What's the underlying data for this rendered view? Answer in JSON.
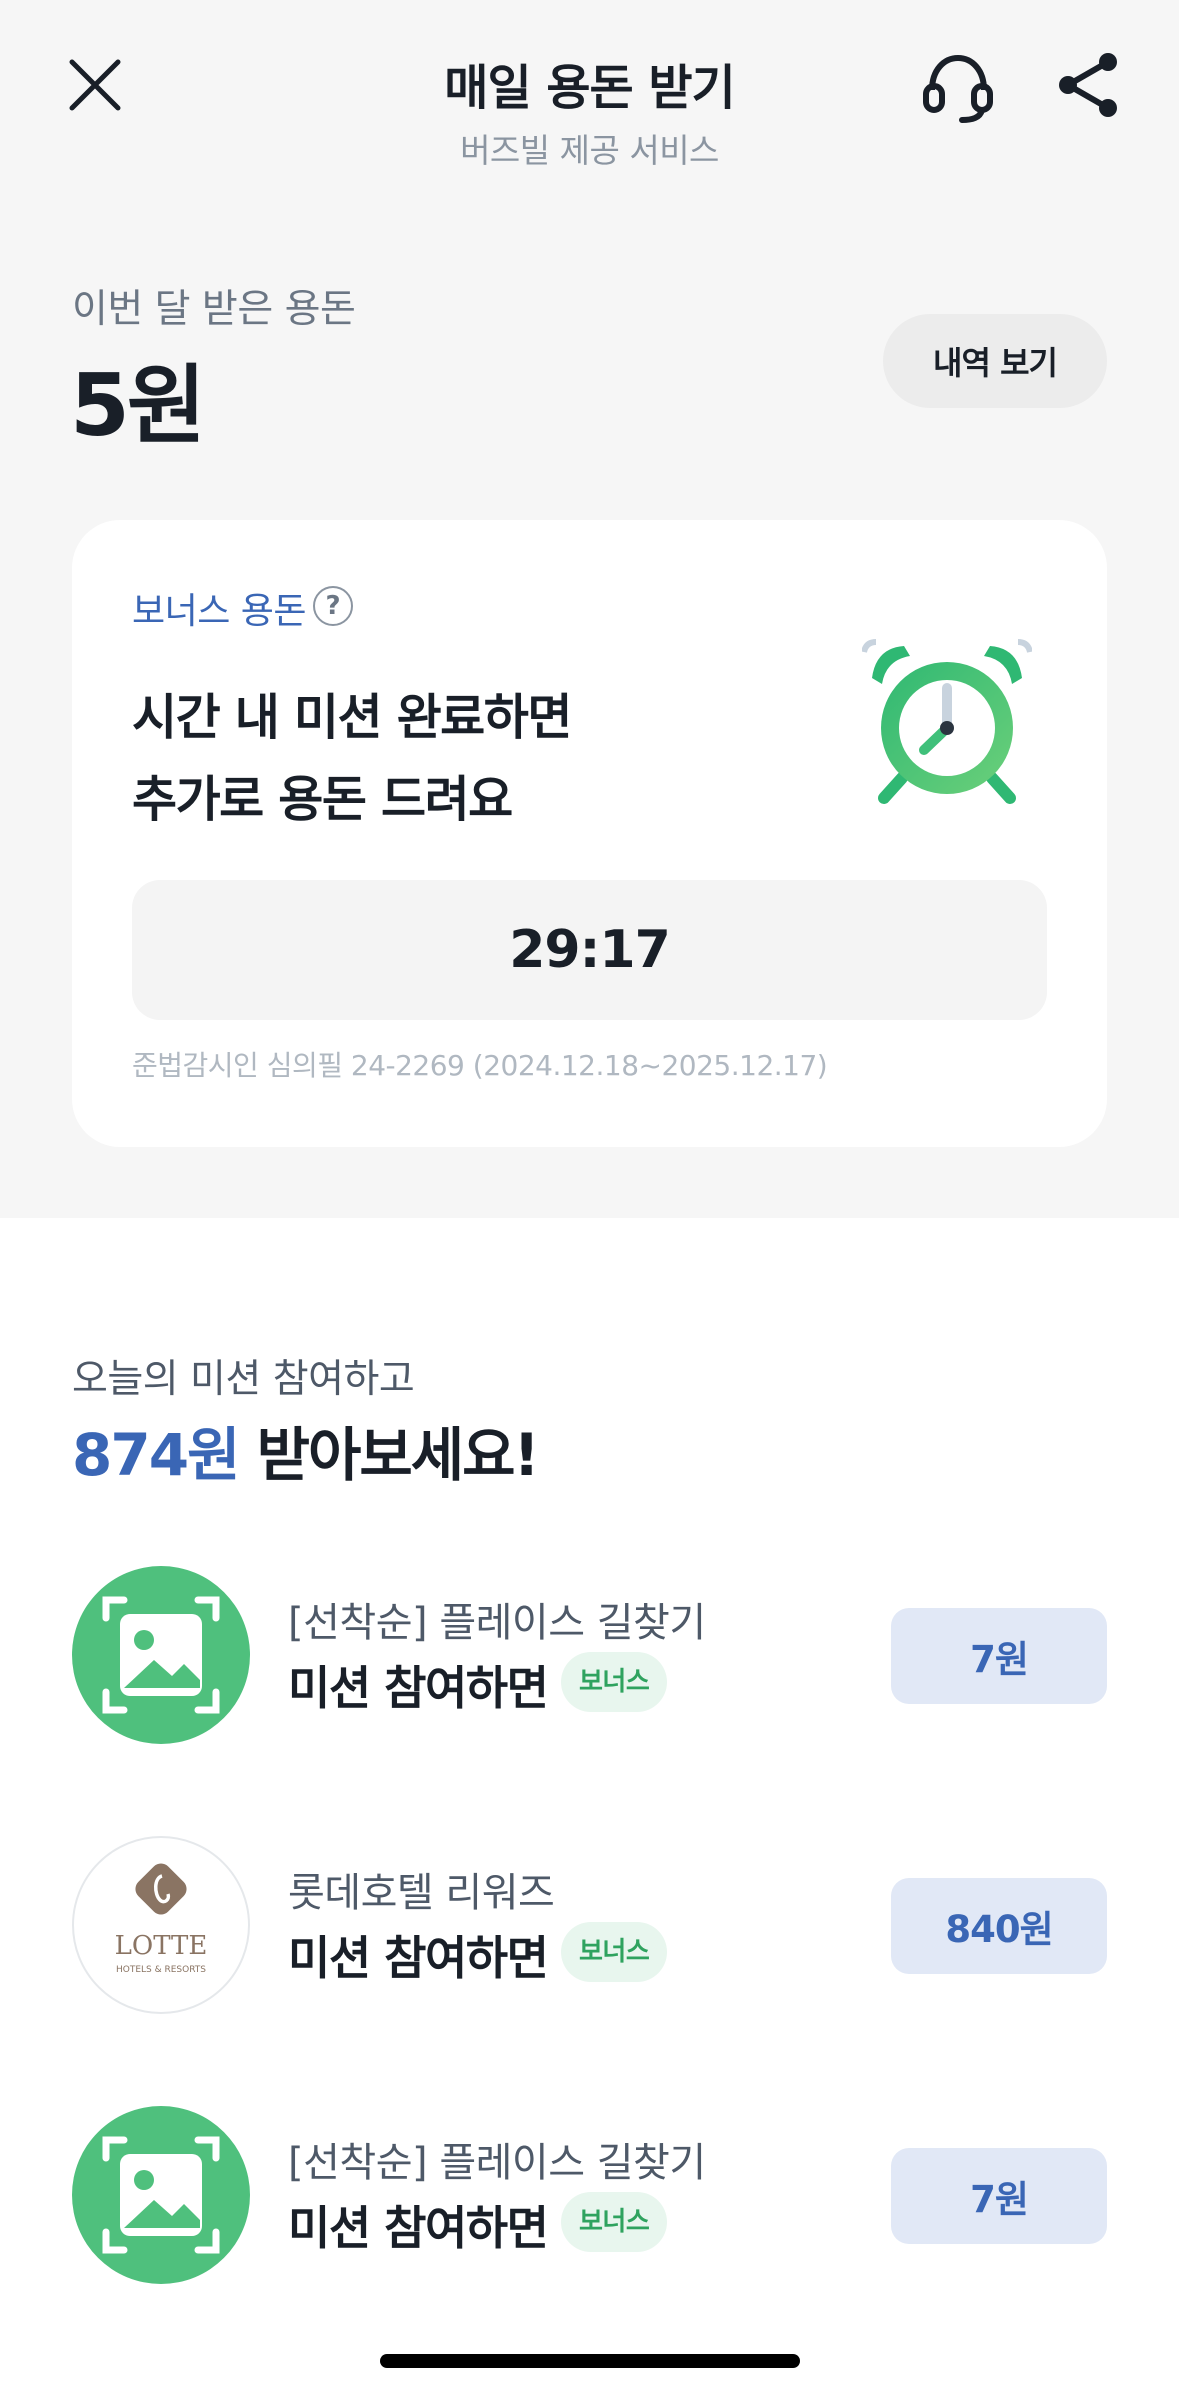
{
  "header": {
    "title": "매일 용돈 받기",
    "subtitle": "버즈빌 제공 서비스",
    "icons": [
      "close-icon",
      "headset-icon",
      "share-icon"
    ]
  },
  "balance": {
    "label": "이번 달 받은 용돈",
    "amount": "5원",
    "history_button": "내역 보기"
  },
  "bonus": {
    "label": "보너스 용돈",
    "help_icon": "?",
    "headline_line1": "시간 내 미션 완료하면",
    "headline_line2": "추가로 용돈 드려요",
    "timer": "29:17",
    "legal": "준법감시인 심의필 24-2269 (2024.12.18~2025.12.17)",
    "icon": "alarm-clock-icon"
  },
  "missions": {
    "subtitle": "오늘의 미션 참여하고",
    "headline_amount": "874원",
    "headline_rest": " 받아보세요!",
    "items": [
      {
        "title": "[선착순] 플레이스 길찾기",
        "desc": "미션 참여하면",
        "badge": "보너스",
        "reward": "7원",
        "icon": "image-placeholder-icon"
      },
      {
        "title": "롯데호텔 리워즈",
        "desc": "미션 참여하면",
        "badge": "보너스",
        "reward": "840원",
        "icon": "lotte-logo"
      },
      {
        "title": "[선착순] 플레이스 길찾기",
        "desc": "미션 참여하면",
        "badge": "보너스",
        "reward": "7원",
        "icon": "image-placeholder-icon"
      }
    ]
  },
  "lotte_logo": {
    "text": "LOTTE",
    "sub": "HOTELS & RESORTS"
  },
  "colors": {
    "accent_blue": "#3a66b5",
    "green": "#4fc07d",
    "badge_bg": "#e8f6ee",
    "reward_bg": "#e1e8f6",
    "top_bg": "#f6f6f6"
  }
}
